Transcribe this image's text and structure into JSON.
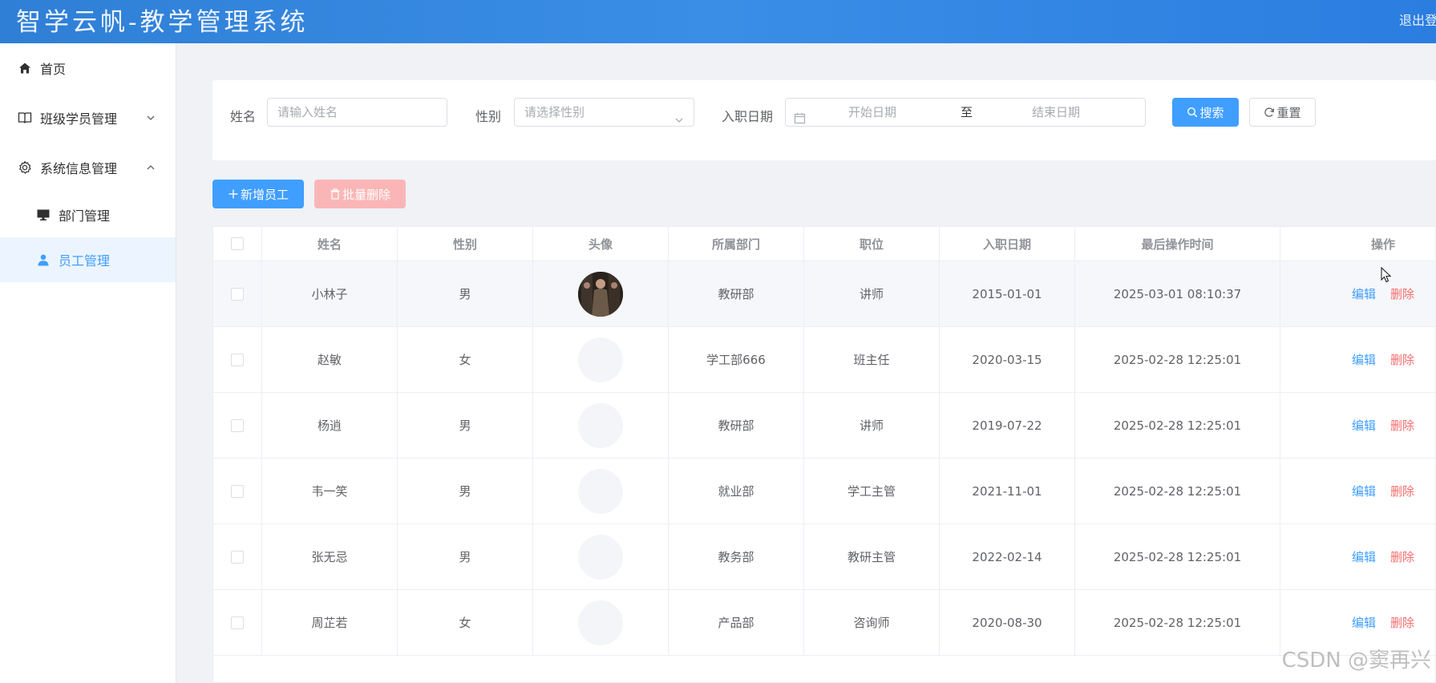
{
  "header": {
    "title": "智学云帆-教学管理系统",
    "logout": "退出登"
  },
  "sidebar": {
    "home": "首页",
    "class_mgmt": "班级学员管理",
    "sys_mgmt": "系统信息管理",
    "dept_mgmt": "部门管理",
    "emp_mgmt": "员工管理"
  },
  "search": {
    "name_label": "姓名",
    "name_placeholder": "请输入姓名",
    "gender_label": "性别",
    "gender_placeholder": "请选择性别",
    "date_label": "入职日期",
    "date_start": "开始日期",
    "date_sep": "至",
    "date_end": "结束日期",
    "search_btn": "搜索",
    "reset_btn": "重置"
  },
  "toolbar": {
    "add_btn": "新增员工",
    "batch_delete_btn": "批量删除"
  },
  "table": {
    "columns": [
      "姓名",
      "性别",
      "头像",
      "所属部门",
      "职位",
      "入职日期",
      "最后操作时间",
      "操作"
    ],
    "edit_label": "编辑",
    "delete_label": "删除",
    "rows": [
      {
        "name": "小林子",
        "gender": "男",
        "dept": "教研部",
        "job": "讲师",
        "entry": "2015-01-01",
        "updated": "2025-03-01 08:10:37"
      },
      {
        "name": "赵敏",
        "gender": "女",
        "dept": "学工部666",
        "job": "班主任",
        "entry": "2020-03-15",
        "updated": "2025-02-28 12:25:01"
      },
      {
        "name": "杨逍",
        "gender": "男",
        "dept": "教研部",
        "job": "讲师",
        "entry": "2019-07-22",
        "updated": "2025-02-28 12:25:01"
      },
      {
        "name": "韦一笑",
        "gender": "男",
        "dept": "就业部",
        "job": "学工主管",
        "entry": "2021-11-01",
        "updated": "2025-02-28 12:25:01"
      },
      {
        "name": "张无忌",
        "gender": "男",
        "dept": "教务部",
        "job": "教研主管",
        "entry": "2022-02-14",
        "updated": "2025-02-28 12:25:01"
      },
      {
        "name": "周芷若",
        "gender": "女",
        "dept": "产品部",
        "job": "咨询师",
        "entry": "2020-08-30",
        "updated": "2025-02-28 12:25:01"
      }
    ]
  },
  "watermark": "CSDN @窦再兴",
  "colors": {
    "primary": "#409eff",
    "danger": "#f56c6c",
    "header": "#3a8ee6"
  }
}
